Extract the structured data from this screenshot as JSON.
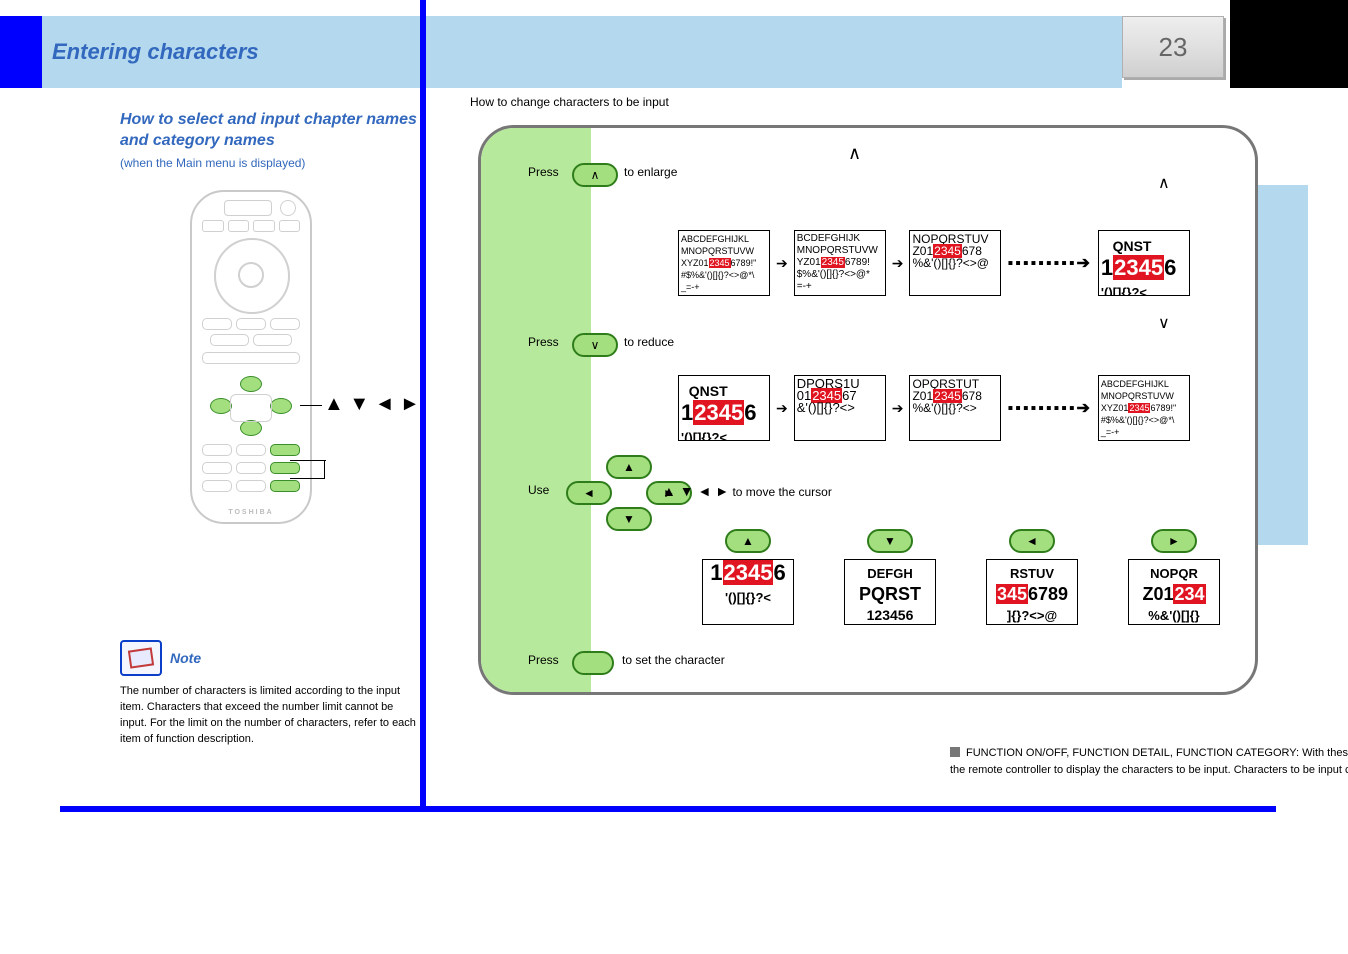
{
  "page_number": "23",
  "header": "Entering characters",
  "left": {
    "title": "How to select and input chapter names and category names",
    "sub": "(when the Main menu is displayed)",
    "arrows_label": "▲ ▼ ◄ ►",
    "note_heading": "Note",
    "note_body": "The number of characters is limited according to the input item. Characters that exceed the number limit cannot be input. For the limit on the number of characters, refer to each item of function description."
  },
  "right": {
    "intro": "How to change characters to be input",
    "row1_label_a": "Press",
    "row1_label_b": "to enlarge",
    "row2_label_a": "Press",
    "row2_label_b": "to reduce",
    "cluster_label_a": "Use",
    "cluster_label_b": "to move the cursor",
    "row4_label_a": "Press",
    "row4_label_b": "to set the character",
    "dir_glyphs": "▲ ▼ ◄ ►",
    "box0": {
      "l1": "ABCDEFGHIJKL",
      "l2": "MNOPQRSTUVW",
      "l3a": "XYZ01",
      "hl": "2345",
      "l3b": "6789!\"",
      "l4": "#$%&'()[]{}?<>@*\\",
      "l5": "_=-+"
    },
    "box_zoom_final": {
      "l1": "   QNST",
      "pre": "1",
      "hl": "2345",
      "post": "6",
      "l3": "'()[]{}?<"
    },
    "box_nav": {
      "up": {
        "pre": "1",
        "hl": "2345",
        "post": "6",
        "l2": "'()[]{}?<"
      },
      "down": {
        "l1": "DEFGH",
        "l2": "PQRST",
        "l3": "123456"
      },
      "left": {
        "l1": "RSTUV",
        "pre": "",
        "hl": "345",
        "post": "6789",
        "l3": "]{}?<>@"
      },
      "right": {
        "l1": "NOPQR",
        "pre": "Z01",
        "hl": "234",
        "post": "",
        "l3": "%&'()[]{}"
      }
    }
  },
  "footnote": "FUNCTION ON/OFF, FUNCTION DETAIL, FUNCTION CATEGORY: With these window displayed, keep pressing the selection buttons ( ▲ ▼ ◄ ► ) on the remote controller to display the characters to be input. Characters to be input can be changed in the same as described above."
}
